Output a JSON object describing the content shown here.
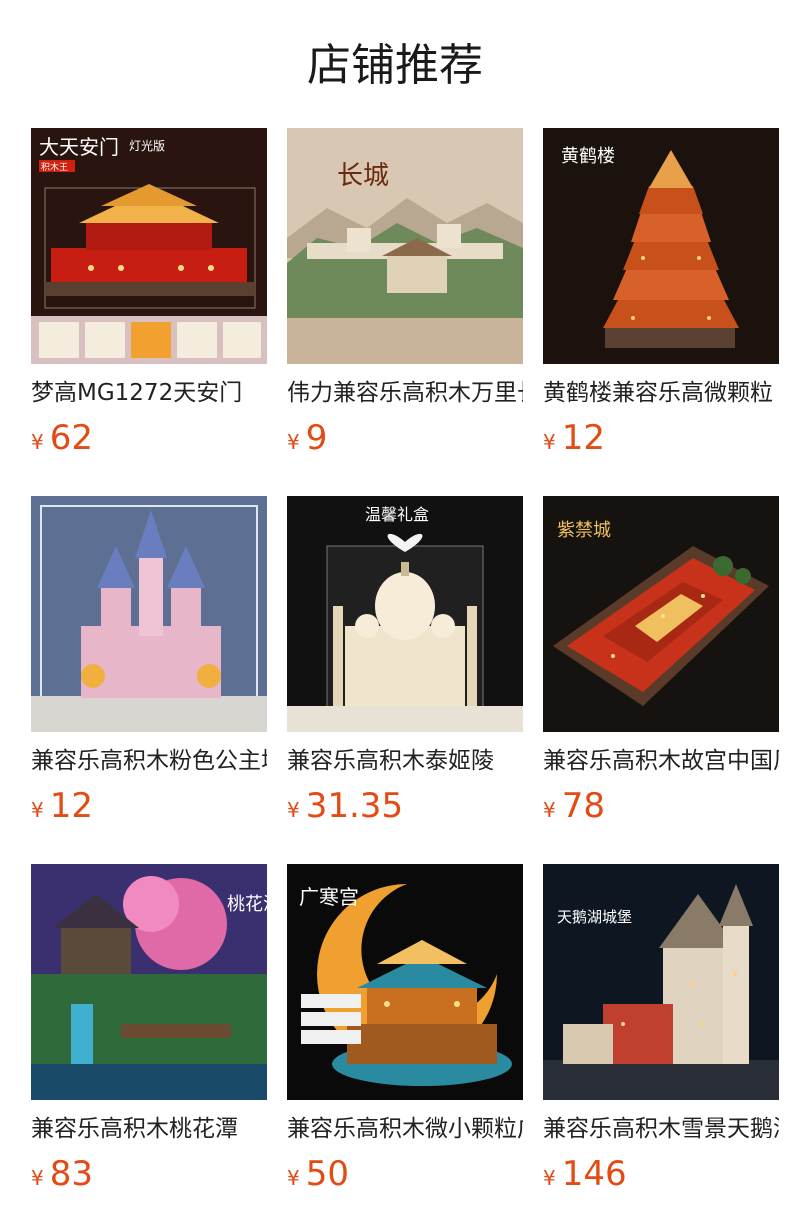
{
  "section": {
    "title": "店铺推荐"
  },
  "products": [
    {
      "name": "梦高MG1272天安门",
      "currency": "¥",
      "price": "62",
      "image": {
        "subject": "tiananmen-model-icon",
        "caption": "大天安门",
        "badge": "灯光版",
        "tag": "积木王",
        "colors": [
          "#2a1410",
          "#c81e12",
          "#f2b24a"
        ]
      }
    },
    {
      "name": "伟力兼容乐高积木万里长城",
      "currency": "¥",
      "price": "9",
      "image": {
        "subject": "great-wall-model-icon",
        "caption": "长城",
        "colors": [
          "#d8c7b3",
          "#7a8a6a",
          "#c9b49a"
        ]
      }
    },
    {
      "name": "黄鹤楼兼容乐高微颗粒",
      "currency": "¥",
      "price": "12",
      "image": {
        "subject": "yellow-crane-tower-icon",
        "caption": "黄鹤楼",
        "colors": [
          "#1b120e",
          "#c8501a",
          "#e8a04a"
        ]
      }
    },
    {
      "name": "兼容乐高积木粉色公主城堡",
      "currency": "¥",
      "price": "12",
      "image": {
        "subject": "pink-castle-icon",
        "caption": "",
        "colors": [
          "#3a4f78",
          "#e7b6c8",
          "#6a7dbf"
        ]
      }
    },
    {
      "name": "兼容乐高积木泰姬陵",
      "currency": "¥",
      "price": "31.35",
      "image": {
        "subject": "taj-mahal-icon",
        "caption": "温馨礼盒",
        "colors": [
          "#111111",
          "#f1e4cc",
          "#cbb895"
        ]
      }
    },
    {
      "name": "兼容乐高积木故宫中国风",
      "currency": "¥",
      "price": "78",
      "image": {
        "subject": "forbidden-city-icon",
        "caption": "紫禁城",
        "colors": [
          "#15120f",
          "#c8321a",
          "#f0c060"
        ]
      }
    },
    {
      "name": "兼容乐高积木桃花潭",
      "currency": "¥",
      "price": "83",
      "image": {
        "subject": "peach-blossom-pool-icon",
        "caption": "桃花潭",
        "colors": [
          "#2a2a5a",
          "#e06aa8",
          "#3fb0d0"
        ]
      }
    },
    {
      "name": "兼容乐高积木微小颗粒广寒宫",
      "currency": "¥",
      "price": "50",
      "image": {
        "subject": "moon-palace-icon",
        "caption": "广寒宫",
        "colors": [
          "#0a0a0a",
          "#f0a030",
          "#2a8aa0"
        ]
      }
    },
    {
      "name": "兼容乐高积木雪景天鹅湖城堡",
      "currency": "¥",
      "price": "146",
      "image": {
        "subject": "swan-lake-castle-icon",
        "caption": "天鹅湖城堡",
        "colors": [
          "#0e1622",
          "#e0d4c0",
          "#c04030"
        ]
      }
    }
  ]
}
